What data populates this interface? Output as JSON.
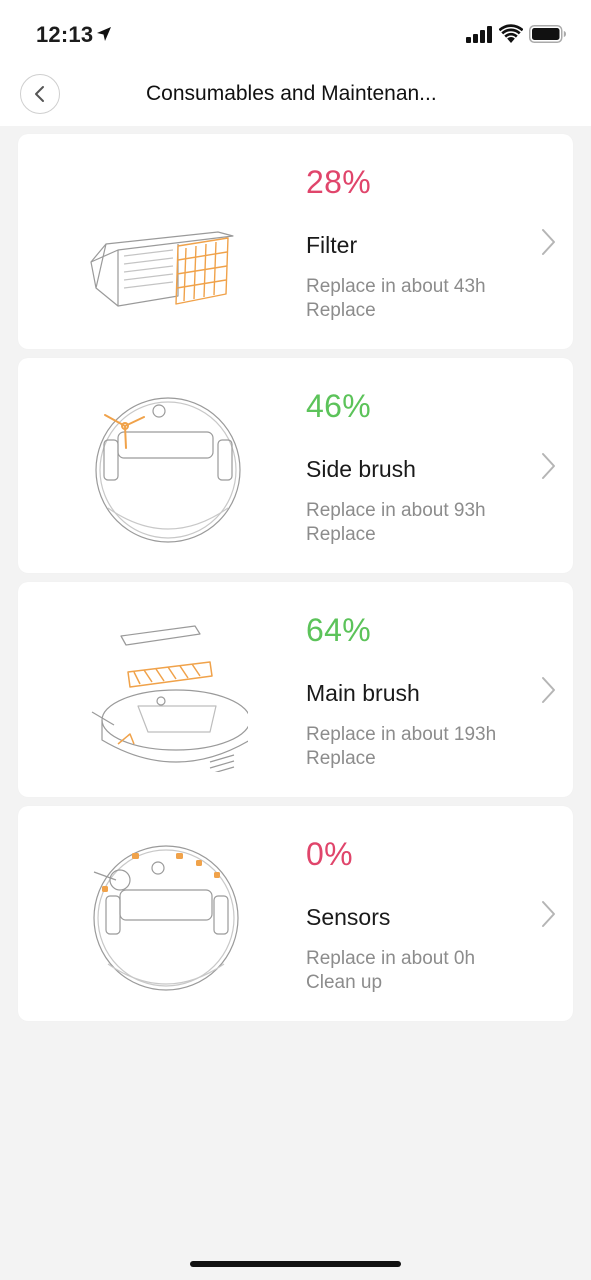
{
  "status_bar": {
    "time": "12:13",
    "icons": [
      "location-arrow-icon",
      "cellular-signal-icon",
      "wifi-icon",
      "battery-icon"
    ]
  },
  "nav": {
    "title": "Consumables and Maintenan...",
    "back_icon": "chevron-left-icon"
  },
  "colors": {
    "low": "#e0456b",
    "ok": "#5cc35a",
    "accent_illustration": "#f0a24a"
  },
  "items": [
    {
      "percent": "28%",
      "percent_value": 28,
      "status": "low",
      "name": "Filter",
      "eta": "Replace in about 43h",
      "action": "Replace",
      "illustration": "filter-illustration"
    },
    {
      "percent": "46%",
      "percent_value": 46,
      "status": "ok",
      "name": "Side brush",
      "eta": "Replace in about 93h",
      "action": "Replace",
      "illustration": "side-brush-illustration"
    },
    {
      "percent": "64%",
      "percent_value": 64,
      "status": "ok",
      "name": "Main brush",
      "eta": "Replace in about 193h",
      "action": "Replace",
      "illustration": "main-brush-illustration"
    },
    {
      "percent": "0%",
      "percent_value": 0,
      "status": "low",
      "name": "Sensors",
      "eta": "Replace in about 0h",
      "action": "Clean up",
      "illustration": "sensors-illustration"
    }
  ]
}
